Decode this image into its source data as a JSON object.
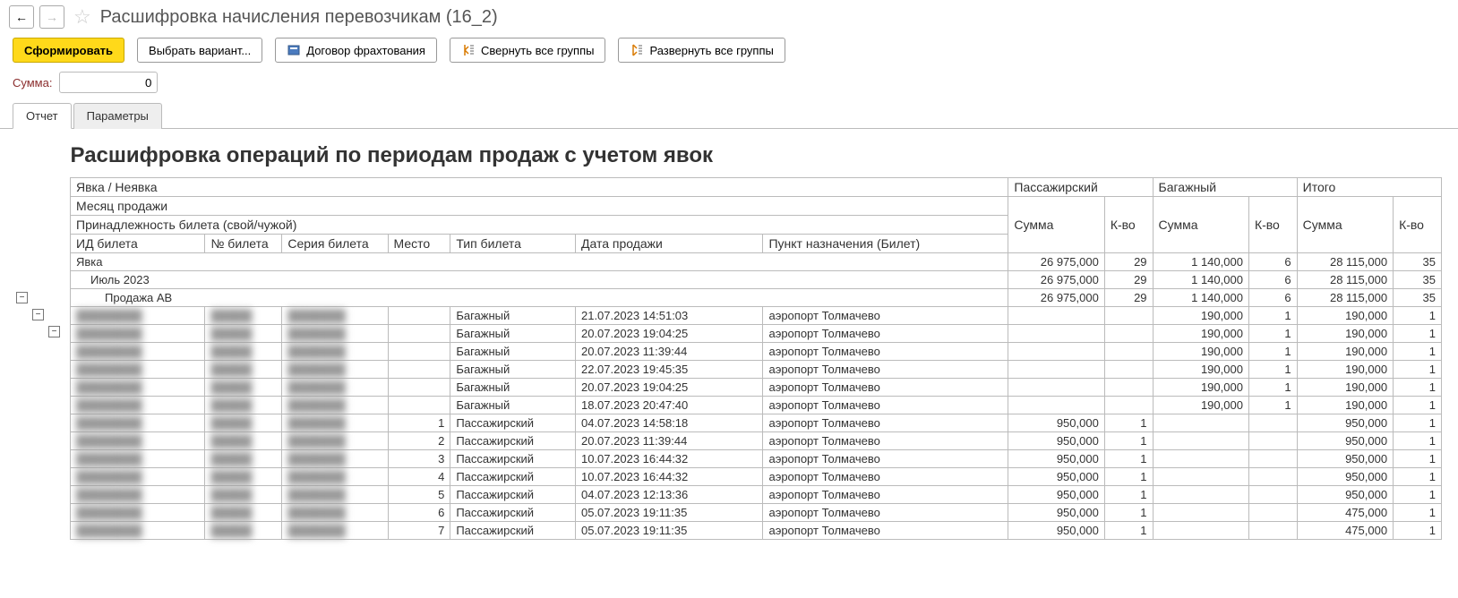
{
  "header": {
    "title": "Расшифровка начисления перевозчикам (16_2)"
  },
  "toolbar": {
    "generate": "Сформировать",
    "select_variant": "Выбрать вариант...",
    "charter": "Договор фрахтования",
    "collapse_all": "Свернуть все группы",
    "expand_all": "Развернуть все группы"
  },
  "sum": {
    "label": "Сумма:",
    "value": "0"
  },
  "tabs": {
    "report": "Отчет",
    "params": "Параметры"
  },
  "report": {
    "title": "Расшифровка операций по периодам продаж с учетом явок",
    "header1": "Явка / Неявка",
    "header2": "Месяц продажи",
    "header3": "Принадлежность билета (свой/чужой)",
    "cols": {
      "ticket_id": "ИД билета",
      "ticket_num": "№ билета",
      "ticket_series": "Серия билета",
      "seat": "Место",
      "ticket_type": "Тип билета",
      "sale_date": "Дата продажи",
      "destination": "Пункт назначения (Билет)",
      "passenger": "Пассажирский",
      "baggage": "Багажный",
      "total": "Итого",
      "sum": "Сумма",
      "count": "К-во"
    },
    "groups": [
      {
        "indent": 0,
        "label": "Явка",
        "psum": "26 975,000",
        "pcnt": "29",
        "bsum": "1 140,000",
        "bcnt": "6",
        "tsum": "28 115,000",
        "tcnt": "35"
      },
      {
        "indent": 1,
        "label": "Июль 2023",
        "psum": "26 975,000",
        "pcnt": "29",
        "bsum": "1 140,000",
        "bcnt": "6",
        "tsum": "28 115,000",
        "tcnt": "35"
      },
      {
        "indent": 2,
        "label": "Продажа АВ",
        "psum": "26 975,000",
        "pcnt": "29",
        "bsum": "1 140,000",
        "bcnt": "6",
        "tsum": "28 115,000",
        "tcnt": "35"
      }
    ],
    "rows": [
      {
        "seat": "",
        "type": "Багажный",
        "date": "21.07.2023 14:51:03",
        "dest": "аэропорт Толмачево",
        "psum": "",
        "pcnt": "",
        "bsum": "190,000",
        "bcnt": "1",
        "tsum": "190,000",
        "tcnt": "1"
      },
      {
        "seat": "",
        "type": "Багажный",
        "date": "20.07.2023 19:04:25",
        "dest": "аэропорт Толмачево",
        "psum": "",
        "pcnt": "",
        "bsum": "190,000",
        "bcnt": "1",
        "tsum": "190,000",
        "tcnt": "1"
      },
      {
        "seat": "",
        "type": "Багажный",
        "date": "20.07.2023 11:39:44",
        "dest": "аэропорт Толмачево",
        "psum": "",
        "pcnt": "",
        "bsum": "190,000",
        "bcnt": "1",
        "tsum": "190,000",
        "tcnt": "1"
      },
      {
        "seat": "",
        "type": "Багажный",
        "date": "22.07.2023 19:45:35",
        "dest": "аэропорт Толмачево",
        "psum": "",
        "pcnt": "",
        "bsum": "190,000",
        "bcnt": "1",
        "tsum": "190,000",
        "tcnt": "1"
      },
      {
        "seat": "",
        "type": "Багажный",
        "date": "20.07.2023 19:04:25",
        "dest": "аэропорт Толмачево",
        "psum": "",
        "pcnt": "",
        "bsum": "190,000",
        "bcnt": "1",
        "tsum": "190,000",
        "tcnt": "1"
      },
      {
        "seat": "",
        "type": "Багажный",
        "date": "18.07.2023 20:47:40",
        "dest": "аэропорт Толмачево",
        "psum": "",
        "pcnt": "",
        "bsum": "190,000",
        "bcnt": "1",
        "tsum": "190,000",
        "tcnt": "1"
      },
      {
        "seat": "1",
        "type": "Пассажирский",
        "date": "04.07.2023 14:58:18",
        "dest": "аэропорт Толмачево",
        "psum": "950,000",
        "pcnt": "1",
        "bsum": "",
        "bcnt": "",
        "tsum": "950,000",
        "tcnt": "1"
      },
      {
        "seat": "2",
        "type": "Пассажирский",
        "date": "20.07.2023 11:39:44",
        "dest": "аэропорт Толмачево",
        "psum": "950,000",
        "pcnt": "1",
        "bsum": "",
        "bcnt": "",
        "tsum": "950,000",
        "tcnt": "1"
      },
      {
        "seat": "3",
        "type": "Пассажирский",
        "date": "10.07.2023 16:44:32",
        "dest": "аэропорт Толмачево",
        "psum": "950,000",
        "pcnt": "1",
        "bsum": "",
        "bcnt": "",
        "tsum": "950,000",
        "tcnt": "1"
      },
      {
        "seat": "4",
        "type": "Пассажирский",
        "date": "10.07.2023 16:44:32",
        "dest": "аэропорт Толмачево",
        "psum": "950,000",
        "pcnt": "1",
        "bsum": "",
        "bcnt": "",
        "tsum": "950,000",
        "tcnt": "1"
      },
      {
        "seat": "5",
        "type": "Пассажирский",
        "date": "04.07.2023 12:13:36",
        "dest": "аэропорт Толмачево",
        "psum": "950,000",
        "pcnt": "1",
        "bsum": "",
        "bcnt": "",
        "tsum": "950,000",
        "tcnt": "1"
      },
      {
        "seat": "6",
        "type": "Пассажирский",
        "date": "05.07.2023 19:11:35",
        "dest": "аэропорт Толмачево",
        "psum": "950,000",
        "pcnt": "1",
        "bsum": "",
        "bcnt": "",
        "tsum": "475,000",
        "tcnt": "1"
      },
      {
        "seat": "7",
        "type": "Пассажирский",
        "date": "05.07.2023 19:11:35",
        "dest": "аэропорт Толмачево",
        "psum": "950,000",
        "pcnt": "1",
        "bsum": "",
        "bcnt": "",
        "tsum": "475,000",
        "tcnt": "1"
      }
    ]
  }
}
